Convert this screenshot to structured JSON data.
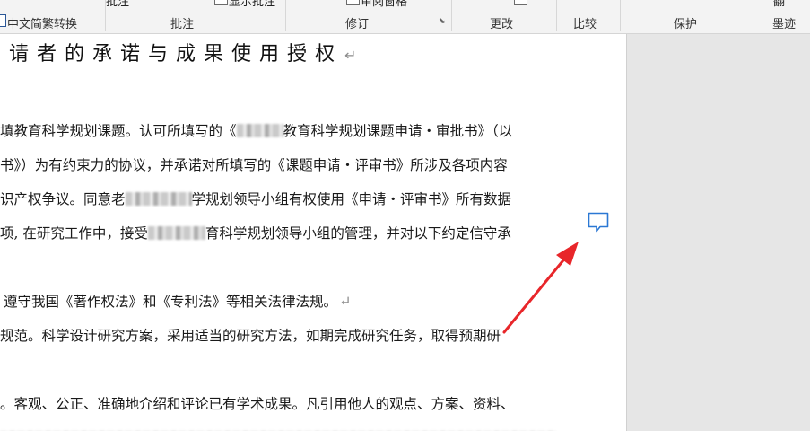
{
  "ribbon": {
    "top_items": [
      "批注",
      "显示批注",
      "审阅窗格",
      "翻"
    ],
    "convert_label": "中文简繁转换",
    "groups": [
      "批注",
      "修订",
      "更改",
      "比较",
      "保护",
      "墨迹"
    ]
  },
  "document": {
    "title": "请者的承诺与成果使用授权",
    "para_mark": "↵",
    "lines": [
      {
        "a": "填教育科学规划课题。认可所填写的《",
        "b": "教育科学规划课题申请・审批书》（以"
      },
      {
        "a": "书》）为有约束力的协议，并承诺对所填写的《课题申请・评审书》所涉及各项内容"
      },
      {
        "a": "识产权争议。同意老",
        "b": "学规划领导小组有权使用《申请・评审书》所有数据"
      },
      {
        "a": "项, 在研究工作中，接受",
        "b": "育科学规划领导小组的管理，并对以下约定信守承"
      },
      {
        "a": "遵守我国《著作权法》和《专利法》等相关法律法规。",
        "mark": "↵"
      },
      {
        "a": "规范。科学设计研究方案，采用适当的研究方法，如期完成研究任务，取得预期研"
      },
      {
        "a": "。客观、公正、准确地介绍和评论已有学术成果。凡引用他人的观点、方案、资料、"
      }
    ]
  }
}
